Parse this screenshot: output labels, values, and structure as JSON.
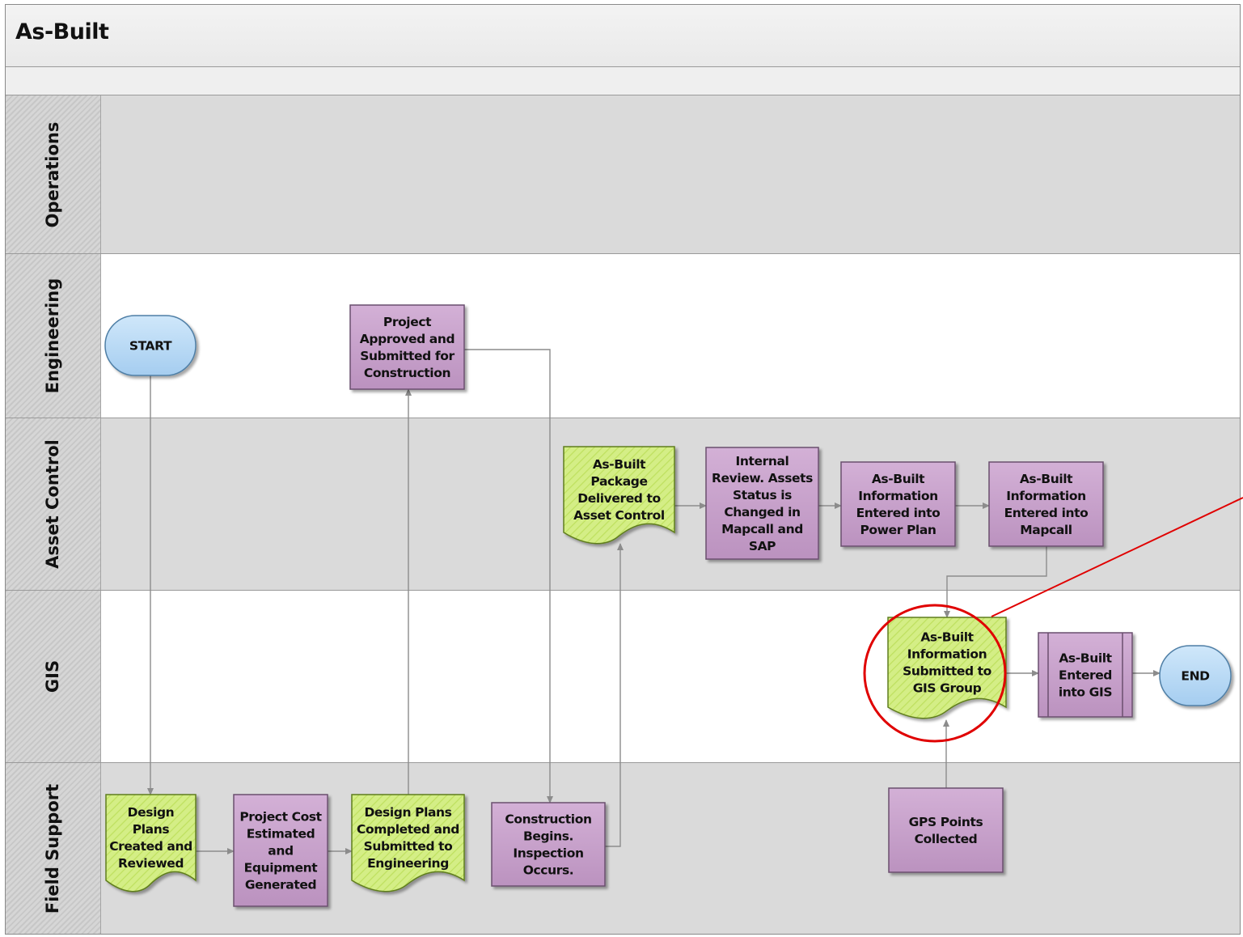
{
  "title": "As-Built",
  "lanes": [
    {
      "id": "operations",
      "label": "Operations"
    },
    {
      "id": "engineering",
      "label": "Engineering"
    },
    {
      "id": "asset_control",
      "label": "Asset Control"
    },
    {
      "id": "gis",
      "label": "GIS"
    },
    {
      "id": "field_support",
      "label": "Field Support"
    }
  ],
  "nodes": {
    "start": {
      "type": "terminator",
      "lane": "engineering",
      "lines": [
        "START"
      ]
    },
    "design_plans_created": {
      "type": "document",
      "lane": "field_support",
      "lines": [
        "Design",
        "Plans",
        "Created and",
        "Reviewed"
      ]
    },
    "project_cost": {
      "type": "process",
      "lane": "field_support",
      "lines": [
        "Project Cost",
        "Estimated",
        "and",
        "Equipment",
        "Generated"
      ]
    },
    "design_plans_completed": {
      "type": "document",
      "lane": "field_support",
      "lines": [
        "Design Plans",
        "Completed and",
        "Submitted to",
        "Engineering"
      ]
    },
    "project_approved": {
      "type": "process",
      "lane": "engineering",
      "lines": [
        "Project",
        "Approved and",
        "Submitted for",
        "Construction"
      ]
    },
    "construction_begins": {
      "type": "process",
      "lane": "field_support",
      "lines": [
        "Construction",
        "Begins.",
        "Inspection",
        "Occurs."
      ]
    },
    "package_delivered": {
      "type": "document",
      "lane": "asset_control",
      "lines": [
        "As-Built",
        "Package",
        "Delivered to",
        "Asset Control"
      ]
    },
    "internal_review": {
      "type": "process",
      "lane": "asset_control",
      "lines": [
        "Internal",
        "Review. Assets",
        "Status is",
        "Changed in",
        "Mapcall and",
        "SAP"
      ]
    },
    "entered_power_plan": {
      "type": "process",
      "lane": "asset_control",
      "lines": [
        "As-Built",
        "Information",
        "Entered into",
        "Power Plan"
      ]
    },
    "entered_mapcall": {
      "type": "process",
      "lane": "asset_control",
      "lines": [
        "As-Built",
        "Information",
        "Entered into",
        "Mapcall"
      ]
    },
    "submitted_gis": {
      "type": "document",
      "lane": "gis",
      "lines": [
        "As-Built",
        "Information",
        "Submitted to",
        "GIS Group"
      ]
    },
    "entered_gis": {
      "type": "predefined-process",
      "lane": "gis",
      "lines": [
        "As-Built",
        "Entered",
        "into GIS"
      ]
    },
    "end": {
      "type": "terminator",
      "lane": "gis",
      "lines": [
        "END"
      ]
    },
    "gps_points": {
      "type": "process",
      "lane": "field_support",
      "lines": [
        "GPS Points",
        "Collected"
      ]
    }
  },
  "edges": [
    [
      "start",
      "design_plans_created"
    ],
    [
      "design_plans_created",
      "project_cost"
    ],
    [
      "project_cost",
      "design_plans_completed"
    ],
    [
      "design_plans_completed",
      "project_approved"
    ],
    [
      "project_approved",
      "construction_begins"
    ],
    [
      "construction_begins",
      "package_delivered"
    ],
    [
      "package_delivered",
      "internal_review"
    ],
    [
      "internal_review",
      "entered_power_plan"
    ],
    [
      "entered_power_plan",
      "entered_mapcall"
    ],
    [
      "entered_mapcall",
      "submitted_gis"
    ],
    [
      "gps_points",
      "submitted_gis"
    ],
    [
      "submitted_gis",
      "entered_gis"
    ],
    [
      "entered_gis",
      "end"
    ]
  ],
  "highlight": {
    "target": "submitted_gis",
    "color": "#e00000"
  },
  "colors": {
    "process_fill": "#c8a2cb",
    "process_stroke": "#6b4f6e",
    "document_fill": "#d4ee86",
    "document_stroke": "#5f7d1e",
    "terminator_fill": "#b9dbf6",
    "terminator_stroke": "#4f7fa6",
    "connector": "#8c8c8c"
  }
}
